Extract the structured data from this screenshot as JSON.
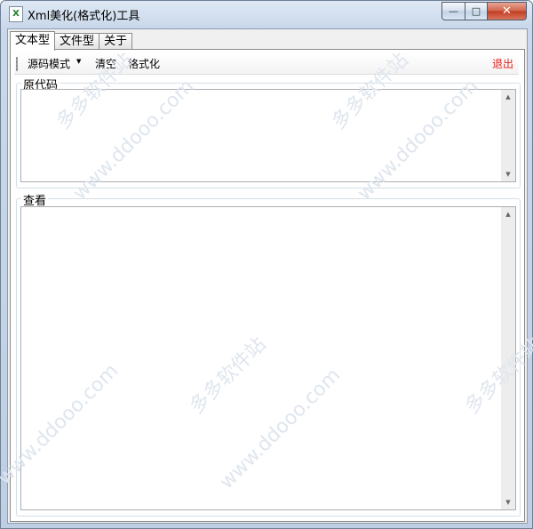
{
  "window": {
    "title": "Xml美化(格式化)工具",
    "icon": "x-file-icon",
    "minimize_glyph": "—",
    "maximize_glyph": "□",
    "close_glyph": "✕"
  },
  "tabs": [
    {
      "label": "文本型",
      "active": true
    },
    {
      "label": "文件型",
      "active": false
    },
    {
      "label": "关于",
      "active": false
    }
  ],
  "toolbar": {
    "mode_label": "源码模式",
    "dropdown_arrow": "▼",
    "clear_label": "清空",
    "format_label": "格式化",
    "exit_label": "退出",
    "exit_color": "#e0201a"
  },
  "source_group": {
    "label": "原代码",
    "value": ""
  },
  "view_group": {
    "label": "查看",
    "value": ""
  },
  "scrollbar": {
    "up_glyph": "▲",
    "down_glyph": "▼"
  },
  "watermarks": {
    "cn": "多多软件站",
    "url": "www.ddooo.com"
  }
}
